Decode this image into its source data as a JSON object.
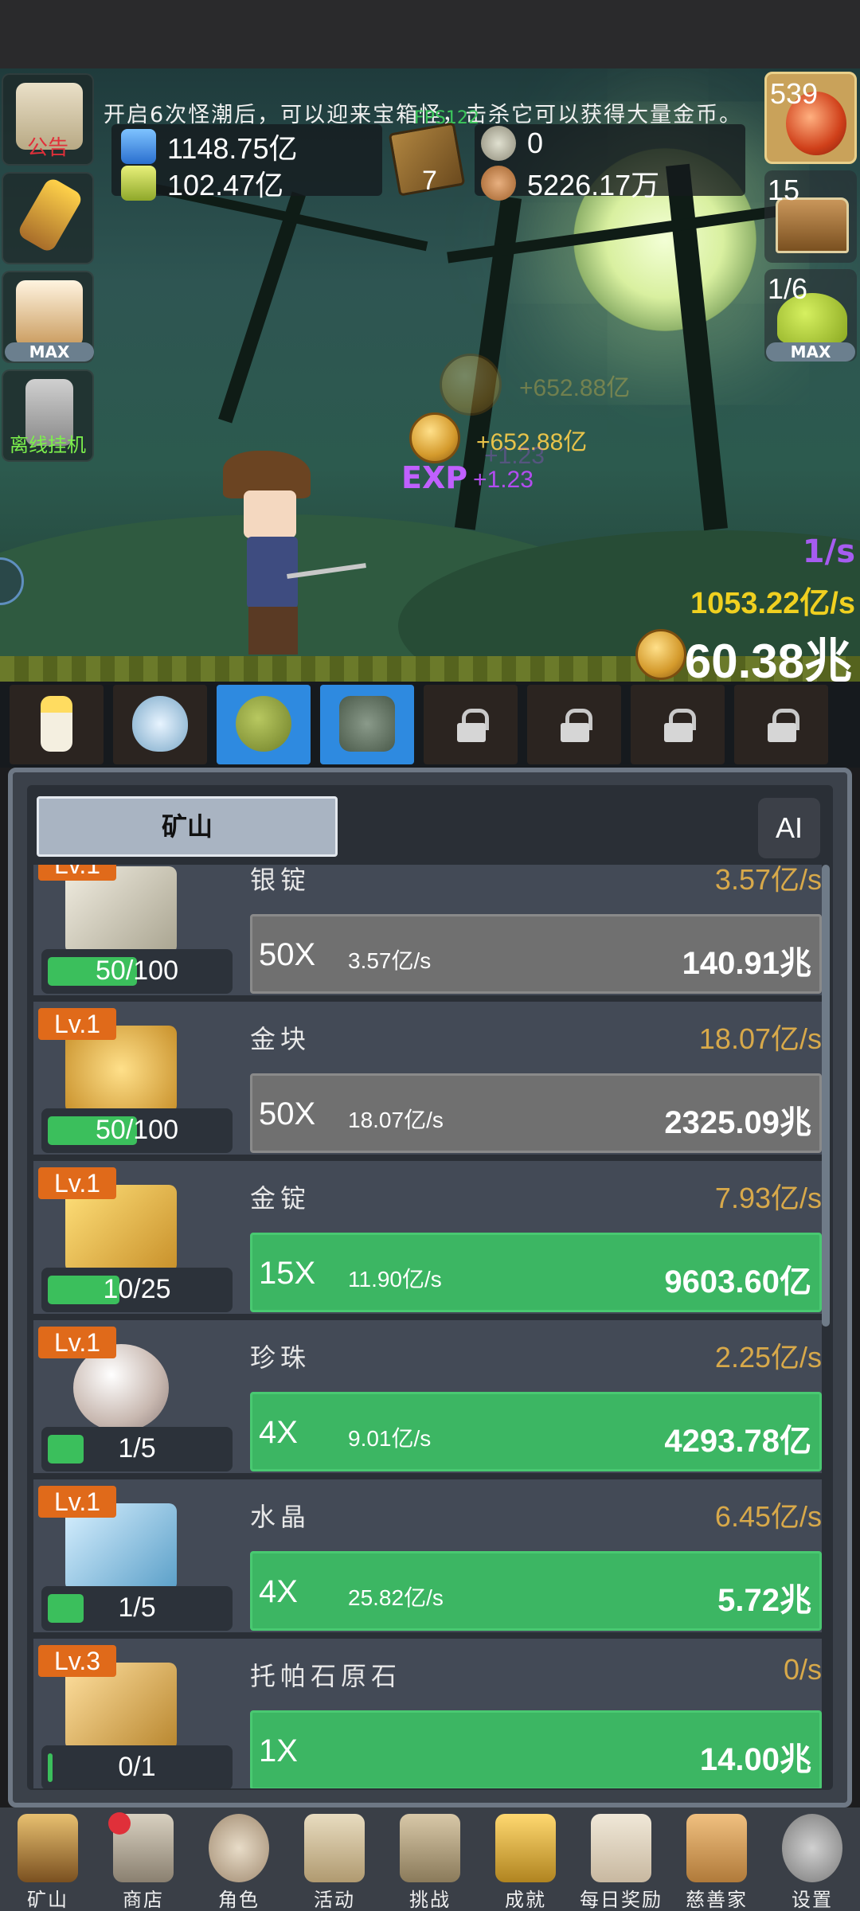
{
  "notice": "开启6次怪潮后，可以迎来宝箱怪，击杀它可以获得大量金币。",
  "fps": "FPS122",
  "resources": {
    "blue_potion": "1148.75亿",
    "green_potion": "102.47亿",
    "book_count": "7",
    "silver_coin": "0",
    "shell": "5226.17万"
  },
  "left_buttons": {
    "notice_label": "公告",
    "torch_label": "",
    "beer_label": "MAX",
    "offline_label": "离线挂机"
  },
  "right_buttons": {
    "potion_count": "539",
    "chest_count": "15",
    "slime_count": "1/6",
    "slime_max": "MAX"
  },
  "floating": {
    "gold_ghost": "+652.88亿",
    "gold": "+652.88亿",
    "exp_label": "EXP",
    "exp": "+1.23",
    "exp_ghost": "+1.23"
  },
  "rates": {
    "per_second_purple": "1/s",
    "gold_rate": "1053.22亿/s",
    "total_gold": "60.38兆"
  },
  "panel": {
    "tab_label": "矿山",
    "ai_label": "AI"
  },
  "mine_items": [
    {
      "level": "Lv.1",
      "name": "银锭",
      "rate": "3.57亿/s",
      "progress_text": "50/100",
      "progress": 0.5,
      "mult": "50X",
      "sub_rate": "3.57亿/s",
      "cost": "140.91兆",
      "affordable": false
    },
    {
      "level": "Lv.1",
      "name": "金块",
      "rate": "18.07亿/s",
      "progress_text": "50/100",
      "progress": 0.5,
      "mult": "50X",
      "sub_rate": "18.07亿/s",
      "cost": "2325.09兆",
      "affordable": false
    },
    {
      "level": "Lv.1",
      "name": "金锭",
      "rate": "7.93亿/s",
      "progress_text": "10/25",
      "progress": 0.4,
      "mult": "15X",
      "sub_rate": "11.90亿/s",
      "cost": "9603.60亿",
      "affordable": true
    },
    {
      "level": "Lv.1",
      "name": "珍珠",
      "rate": "2.25亿/s",
      "progress_text": "1/5",
      "progress": 0.2,
      "mult": "4X",
      "sub_rate": "9.01亿/s",
      "cost": "4293.78亿",
      "affordable": true
    },
    {
      "level": "Lv.1",
      "name": "水晶",
      "rate": "6.45亿/s",
      "progress_text": "1/5",
      "progress": 0.2,
      "mult": "4X",
      "sub_rate": "25.82亿/s",
      "cost": "5.72兆",
      "affordable": true
    },
    {
      "level": "Lv.3",
      "name": "托帕石原石",
      "rate": "0/s",
      "progress_text": "0/1",
      "progress": 0.02,
      "mult": "1X",
      "sub_rate": "",
      "cost": "14.00兆",
      "affordable": true
    }
  ],
  "nav": [
    "矿山",
    "商店",
    "角色",
    "活动",
    "挑战",
    "成就",
    "每日奖励",
    "慈善家",
    "设置"
  ],
  "colors": {
    "accent_green": "#3cb663",
    "level_orange": "#e06a1a",
    "gold_text": "#d8a94a",
    "exp_purple": "#b34cf0"
  }
}
